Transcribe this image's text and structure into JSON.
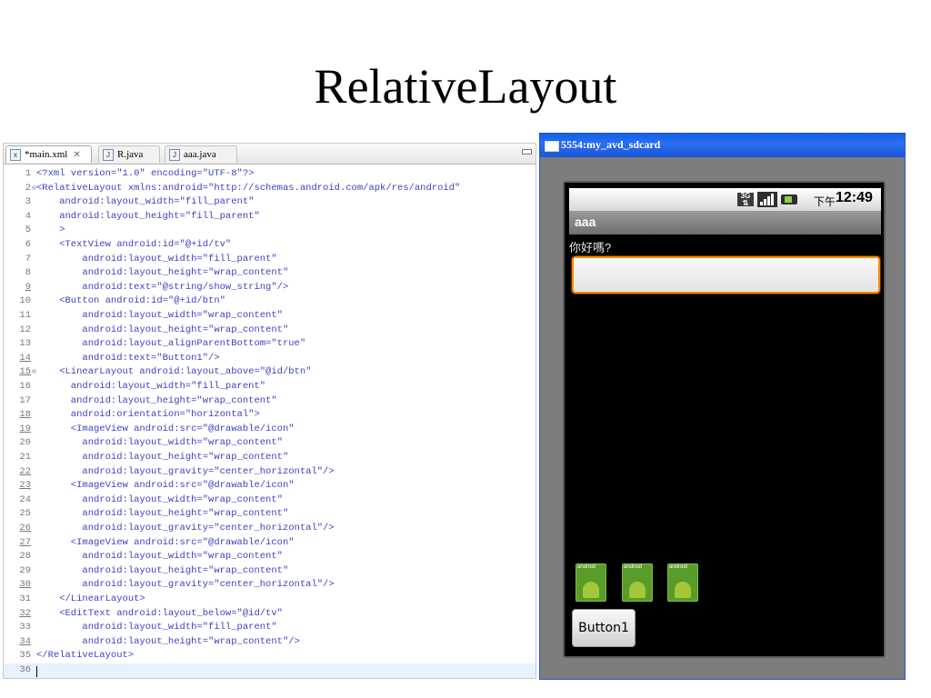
{
  "slide": {
    "title": "RelativeLayout"
  },
  "editor": {
    "tabs": [
      {
        "label": "*main.xml",
        "active": true,
        "icon": "xml-file-icon"
      },
      {
        "label": "R.java",
        "active": false,
        "icon": "java-file-icon"
      },
      {
        "label": "aaa.java",
        "active": false,
        "icon": "java-file-icon"
      }
    ],
    "lines": [
      "<?xml version=\"1.0\" encoding=\"UTF-8\"?>",
      "<RelativeLayout xmlns:android=\"http://schemas.android.com/apk/res/android\"",
      "    android:layout_width=\"fill_parent\"",
      "    android:layout_height=\"fill_parent\"",
      "    >",
      "    <TextView android:id=\"@+id/tv\"",
      "        android:layout_width=\"fill_parent\"",
      "        android:layout_height=\"wrap_content\"",
      "        android:text=\"@string/show_string\"/>",
      "    <Button android:id=\"@+id/btn\"",
      "        android:layout_width=\"wrap_content\"",
      "        android:layout_height=\"wrap_content\"",
      "        android:layout_alignParentBottom=\"true\"",
      "        android:text=\"Button1\"/>",
      "    <LinearLayout android:layout_above=\"@id/btn\"",
      "      android:layout_width=\"fill_parent\"",
      "      android:layout_height=\"wrap_content\"",
      "      android:orientation=\"horizontal\">",
      "      <ImageView android:src=\"@drawable/icon\"",
      "        android:layout_width=\"wrap_content\"",
      "        android:layout_height=\"wrap_content\"",
      "        android:layout_gravity=\"center_horizontal\"/>",
      "      <ImageView android:src=\"@drawable/icon\"",
      "        android:layout_width=\"wrap_content\"",
      "        android:layout_height=\"wrap_content\"",
      "        android:layout_gravity=\"center_horizontal\"/>",
      "      <ImageView android:src=\"@drawable/icon\"",
      "        android:layout_width=\"wrap_content\"",
      "        android:layout_height=\"wrap_content\"",
      "        android:layout_gravity=\"center_horizontal\"/>",
      "    </LinearLayout>",
      "    <EditText android:layout_below=\"@id/tv\"",
      "        android:layout_width=\"fill_parent\"",
      "        android:layout_height=\"wrap_content\"/>",
      "</RelativeLayout>",
      ""
    ]
  },
  "emulator": {
    "window_title": "5554:my_avd_sdcard",
    "status": {
      "network": "3G",
      "ampm": "下午",
      "time": "12:49"
    },
    "app_title": "aaa",
    "textview_text": "你好嗎?",
    "edittext_value": "",
    "icon_label": "android",
    "button_label": "Button1"
  }
}
